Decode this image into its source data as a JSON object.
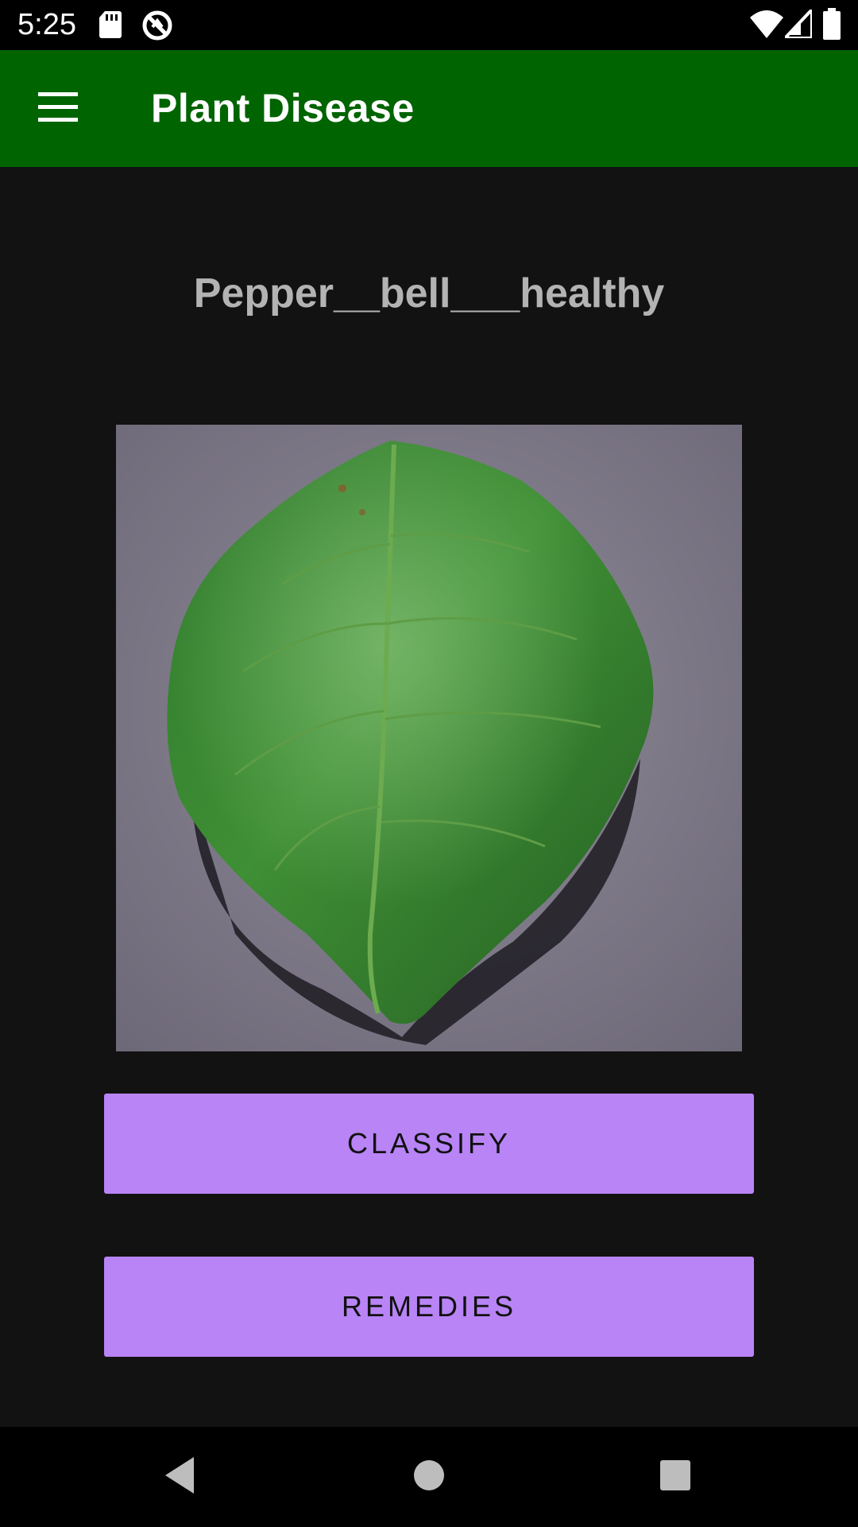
{
  "status_bar": {
    "time": "5:25",
    "icons": [
      "sd-card-icon",
      "sync-disabled-icon",
      "wifi-icon",
      "signal-icon",
      "battery-icon"
    ]
  },
  "app_bar": {
    "title": "Plant Disease",
    "menu_icon": "hamburger-menu-icon",
    "background_color": "#006400"
  },
  "main": {
    "result_label": "Pepper__bell___healthy",
    "image": "pepper-bell-leaf",
    "buttons": {
      "classify_label": "CLASSIFY",
      "remedies_label": "REMEDIES"
    },
    "button_color": "#b884f6"
  },
  "nav_bar": {
    "icons": [
      "back-icon",
      "home-icon",
      "recents-icon"
    ]
  }
}
